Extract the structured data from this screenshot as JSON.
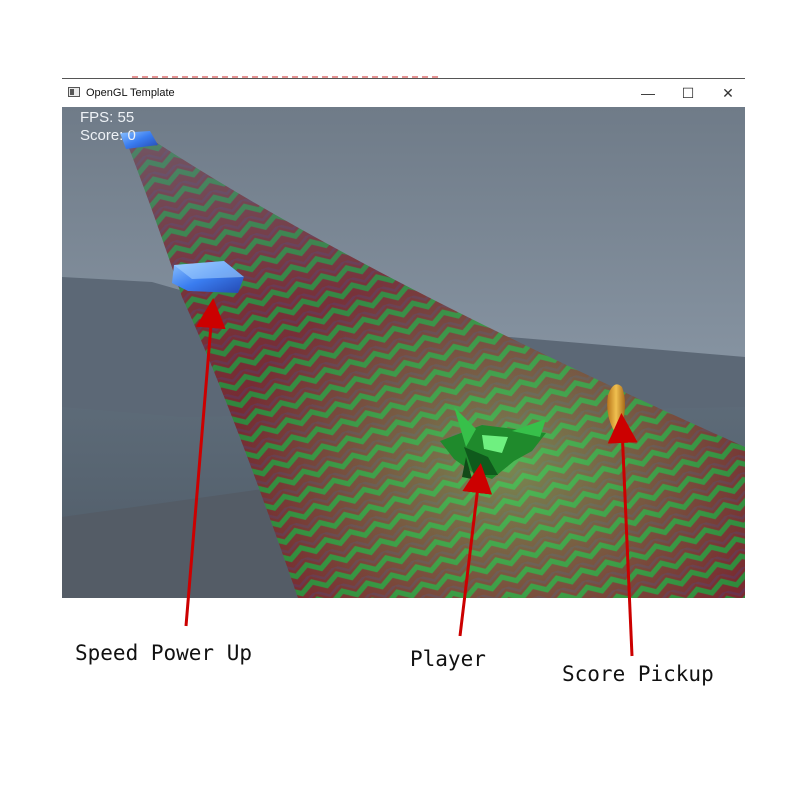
{
  "window": {
    "title": "OpenGL Template",
    "minimize_glyph": "—",
    "maximize_glyph": "☐",
    "close_glyph": "✕"
  },
  "hud": {
    "fps": "FPS: 55",
    "score": "Score: 0"
  },
  "annotations": {
    "speed_power_up": "Speed Power Up",
    "player": "Player",
    "score_pickup": "Score Pickup"
  },
  "colors": {
    "arrow": "#cc0000",
    "sky": "#7a8896",
    "track_green": "#3aa83a",
    "track_red": "#8b2028",
    "power_up_blue": "#3f7ff0",
    "pickup_gold": "#d9a030"
  }
}
